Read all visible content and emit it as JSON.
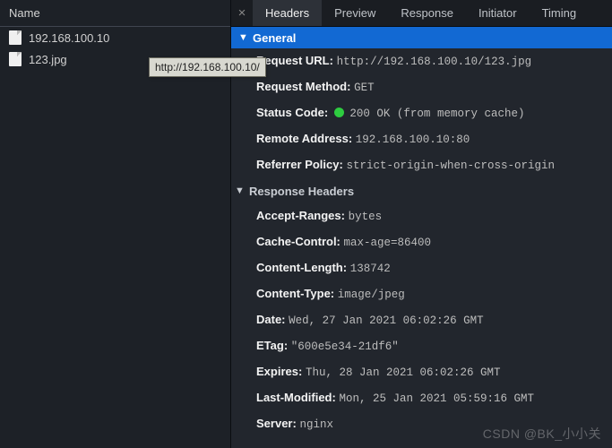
{
  "left": {
    "header": "Name",
    "files": [
      {
        "name": "192.168.100.10"
      },
      {
        "name": "123.jpg"
      }
    ]
  },
  "tooltip": "http://192.168.100.10/",
  "tabs": {
    "close_glyph": "×",
    "items": [
      {
        "label": "Headers",
        "active": true
      },
      {
        "label": "Preview"
      },
      {
        "label": "Response"
      },
      {
        "label": "Initiator"
      },
      {
        "label": "Timing"
      }
    ]
  },
  "sections": {
    "general_label": "General",
    "response_headers_label": "Response Headers",
    "disclosure_glyph": "▼"
  },
  "general": {
    "request_url": {
      "k": "Request URL:",
      "v": "http://192.168.100.10/123.jpg"
    },
    "request_method": {
      "k": "Request Method:",
      "v": "GET"
    },
    "status_code": {
      "k": "Status Code:",
      "v": "200 OK (from memory cache)"
    },
    "remote_address": {
      "k": "Remote Address:",
      "v": "192.168.100.10:80"
    },
    "referrer_policy": {
      "k": "Referrer Policy:",
      "v": "strict-origin-when-cross-origin"
    }
  },
  "response": {
    "accept_ranges": {
      "k": "Accept-Ranges:",
      "v": "bytes"
    },
    "cache_control": {
      "k": "Cache-Control:",
      "v": "max-age=86400"
    },
    "content_length": {
      "k": "Content-Length:",
      "v": "138742"
    },
    "content_type": {
      "k": "Content-Type:",
      "v": "image/jpeg"
    },
    "date": {
      "k": "Date:",
      "v": "Wed, 27 Jan 2021 06:02:26 GMT"
    },
    "etag": {
      "k": "ETag:",
      "v": "\"600e5e34-21df6\""
    },
    "expires": {
      "k": "Expires:",
      "v": "Thu, 28 Jan 2021 06:02:26 GMT"
    },
    "last_modified": {
      "k": "Last-Modified:",
      "v": "Mon, 25 Jan 2021 05:59:16 GMT"
    },
    "server": {
      "k": "Server:",
      "v": "nginx"
    }
  },
  "watermark": "CSDN @BK_小小关"
}
